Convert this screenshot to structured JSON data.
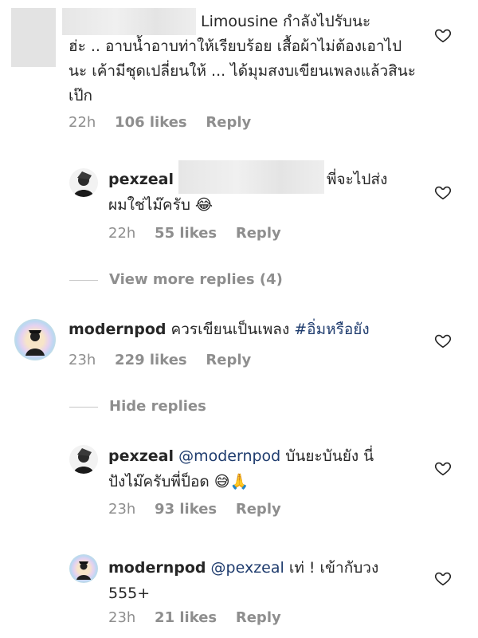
{
  "comment1": {
    "text_line1": "Limousine กำลังไปรับนะ",
    "text_rest": "ฮ่ะ .. อาบน้ำอาบท่าให้เรียบร้อย เสื้อผ้าไม่ต้องเอาไปนะ เค้ามีชุดเปลี่ยนให้ ... ได้มุมสงบเขียนเพลงแล้วสินะเป๊ก",
    "time": "22h",
    "likes": "106 likes",
    "reply": "Reply"
  },
  "reply1": {
    "username": "pexzeal",
    "text_end": "พี่จะไปส่ง",
    "text_line2": "ผมใช่ไม๊ครับ 😂",
    "time": "22h",
    "likes": "55 likes",
    "reply": "Reply"
  },
  "view_more": "View more replies (4)",
  "comment2": {
    "username": "modernpod",
    "text": "ควรเขียนเป็นเพลง",
    "hashtag": "#อิ่มหรือยัง",
    "time": "23h",
    "likes": "229 likes",
    "reply": "Reply"
  },
  "hide_replies": "Hide replies",
  "reply2": {
    "username": "pexzeal",
    "mention": "@modernpod",
    "text_line1": "บันยะบันยัง นี่",
    "text_line2": "ปังไม๊ครับพี่ป็อด 😅🙏",
    "time": "23h",
    "likes": "93 likes",
    "reply": "Reply"
  },
  "reply3": {
    "username": "modernpod",
    "mention": "@pexzeal",
    "text_line1": "เท่ ! เข้ากับวง",
    "text_line2": "555+",
    "time": "23h",
    "likes": "21 likes",
    "reply": "Reply"
  },
  "icons": [
    "heart-outline-icon"
  ]
}
